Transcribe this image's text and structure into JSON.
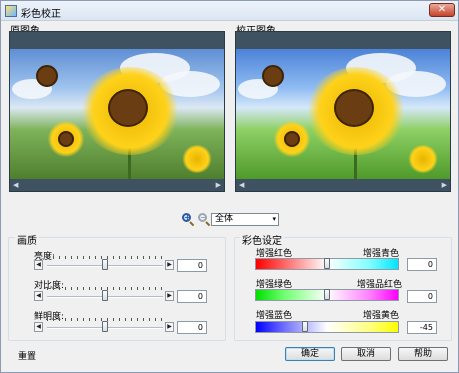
{
  "window": {
    "title": "彩色校正",
    "close_glyph": "✕"
  },
  "panels": {
    "original_label": "原图象",
    "corrected_label": "校正图象"
  },
  "zoom": {
    "select_value": "全体",
    "select_caret": "▾",
    "zoom_in_sign": "+",
    "zoom_out_sign": "−"
  },
  "image_group": {
    "title": "画质",
    "sliders": [
      {
        "label": "亮度:",
        "value": "0",
        "level": 0.5
      },
      {
        "label": "对比度:",
        "value": "0",
        "level": 0.5
      },
      {
        "label": "鲜明度:",
        "value": "0",
        "level": 0.5
      }
    ]
  },
  "color_group": {
    "title": "彩色设定",
    "sliders": [
      {
        "left_label": "增强红色",
        "right_label": "增强青色",
        "value": "0",
        "level": 0.5
      },
      {
        "left_label": "增强绿色",
        "right_label": "增强品红色",
        "value": "0",
        "level": 0.5
      },
      {
        "left_label": "增强蓝色",
        "right_label": "增强黄色",
        "value": "-45",
        "level": 0.35
      }
    ]
  },
  "arrows": {
    "left": "◀",
    "right": "▶"
  },
  "scroll_arrows": {
    "left": "◀",
    "right": "▶"
  },
  "buttons": {
    "reset": "重置",
    "ok": "确定",
    "cancel": "取消",
    "help": "帮助"
  },
  "colors": {
    "title_accent": "#dbe5f2",
    "frame": "#3f5262"
  }
}
